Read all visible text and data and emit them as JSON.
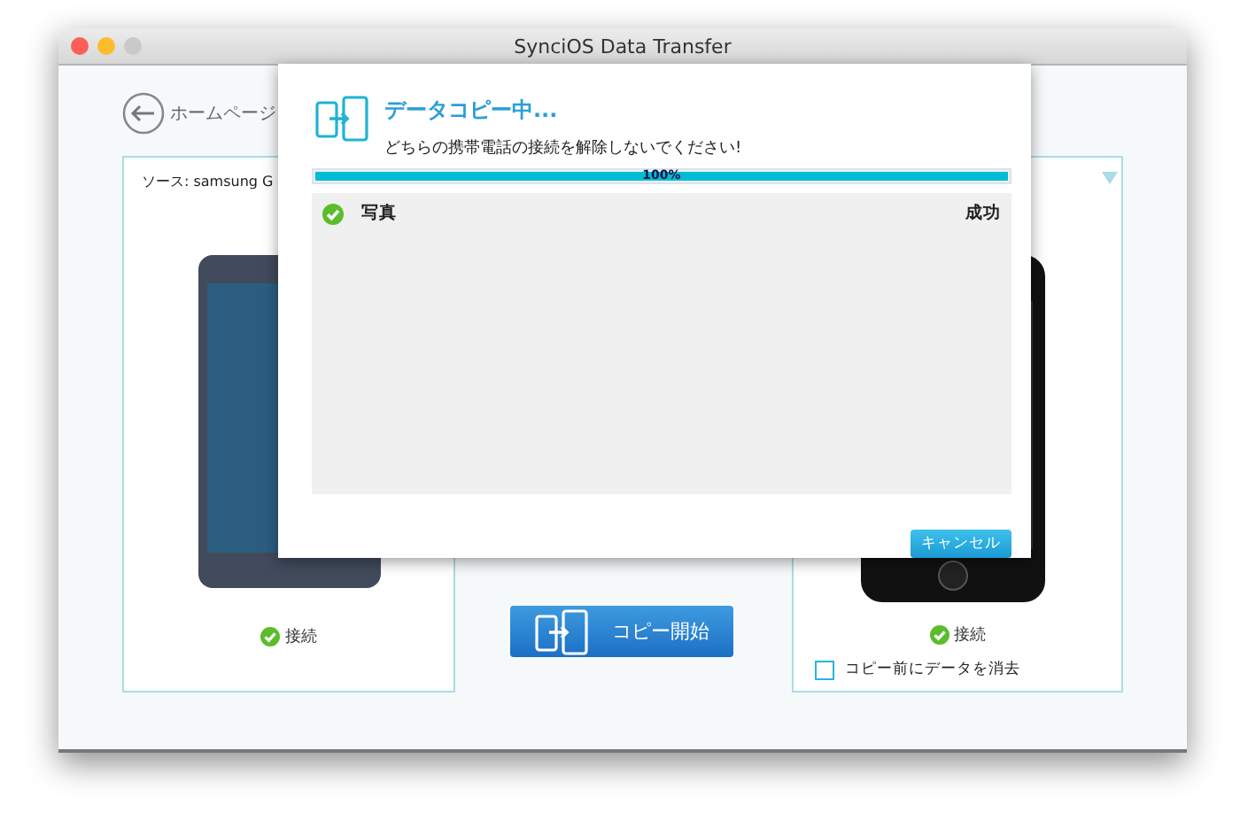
{
  "window": {
    "title": "SynciOS Data Transfer"
  },
  "home_button": {
    "label": "ホームページ"
  },
  "source_panel": {
    "label": "ソース: samsung G",
    "status": "接続"
  },
  "copy_button": {
    "label": "コピー開始"
  },
  "target_panel": {
    "status": "接続",
    "clear_option": {
      "label": "コピー前にデータを消去",
      "checked": false
    }
  },
  "dialog": {
    "title": "データコピー中...",
    "message": "どちらの携帯電話の接続を解除しないでください!",
    "progress": {
      "level": 1,
      "reading": "100%"
    },
    "items": [
      {
        "name": "写真",
        "result": "成功",
        "done": true
      }
    ],
    "cancel_button": "キャンセル"
  }
}
